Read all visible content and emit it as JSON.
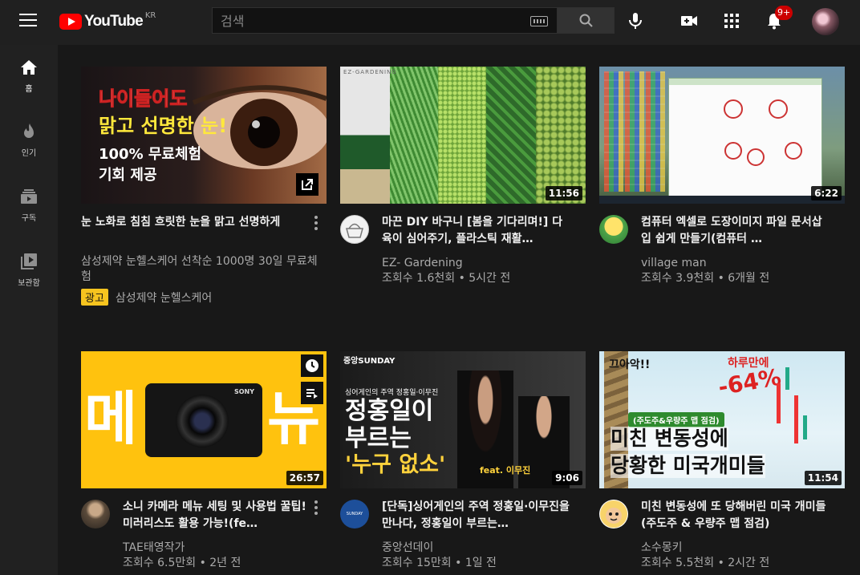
{
  "header": {
    "logo_text": "YouTube",
    "country": "KR",
    "search_placeholder": "검색",
    "notification_count": "9+"
  },
  "sidebar": {
    "items": [
      {
        "label": "홈"
      },
      {
        "label": "인기"
      },
      {
        "label": "구독"
      },
      {
        "label": "보관함"
      }
    ]
  },
  "videos": [
    {
      "title": "눈 노화로 침침 흐릿한 눈을 맑고 선명하게",
      "meta1": "삼성제약 눈헬스케어 선착순 1000명 30일 무료체험",
      "ad_badge": "광고",
      "ad_channel": "삼성제약 눈헬스케어",
      "thumb_lines": [
        "나이들어도",
        "맑고 선명한 눈!",
        "100% 무료체험",
        "기회 제공"
      ]
    },
    {
      "title": "마끈 DIY 바구니 [봄을 기다리며!] 다육이 심어주기, 플라스틱 재활…",
      "channel": "EZ- Gardening",
      "stats": "조회수 1.6천회 • 5시간 전",
      "duration": "11:56",
      "thumb_caption": "EZ-GARDENING"
    },
    {
      "title": "컴퓨터 엑셀로 도장이미지 파일 문서삽입 쉽게 만들기(컴퓨터 …",
      "channel": "village man",
      "stats": "조회수 3.9천회 • 6개월 전",
      "duration": "6:22"
    },
    {
      "title": "소니 카메라 메뉴 세팅 및 사용법 꿀팁! 미러리스도 활용 가능!(fe…",
      "channel": "TAE태영작가",
      "stats": "조회수 6.5만회 • 2년 전",
      "duration": "26:57",
      "thumb_left": "메",
      "thumb_right": "뉴",
      "thumb_brand": "SONY"
    },
    {
      "title": "[단독]싱어게인의 주역 정홍일·이무진을 만나다, 정홍일이 부르는…",
      "channel": "중앙선데이",
      "stats": "조회수 15만회 • 1일 전",
      "duration": "9:06",
      "thumb_brand": "중앙SUNDAY",
      "thumb_sub": "싱어게인의 주역 정홍일·이무진",
      "thumb_line1": "정홍일이",
      "thumb_line2": "부르는",
      "thumb_line3": "'누구 없소'",
      "thumb_feat": "feat. 이무진"
    },
    {
      "title": "미친 변동성에 또 당해버린 미국 개미들(주도주 & 우량주 맵 점검)",
      "channel": "소수몽키",
      "stats": "조회수 5.5천회 • 2시간 전",
      "duration": "11:54",
      "thumb_pct": "-64%",
      "thumb_top": "하루만에",
      "thumb_tag": "(주도주&우량주 맵 점검)",
      "thumb_l1": "미친 변동성에",
      "thumb_l2": "당황한 미국개미들",
      "thumb_corner": "끄아악!!"
    }
  ],
  "colors": {
    "background": "#181818",
    "header": "#202020",
    "sidebar": "#212121",
    "accent_red": "#ff0000",
    "ad_badge": "#f7c41f"
  }
}
